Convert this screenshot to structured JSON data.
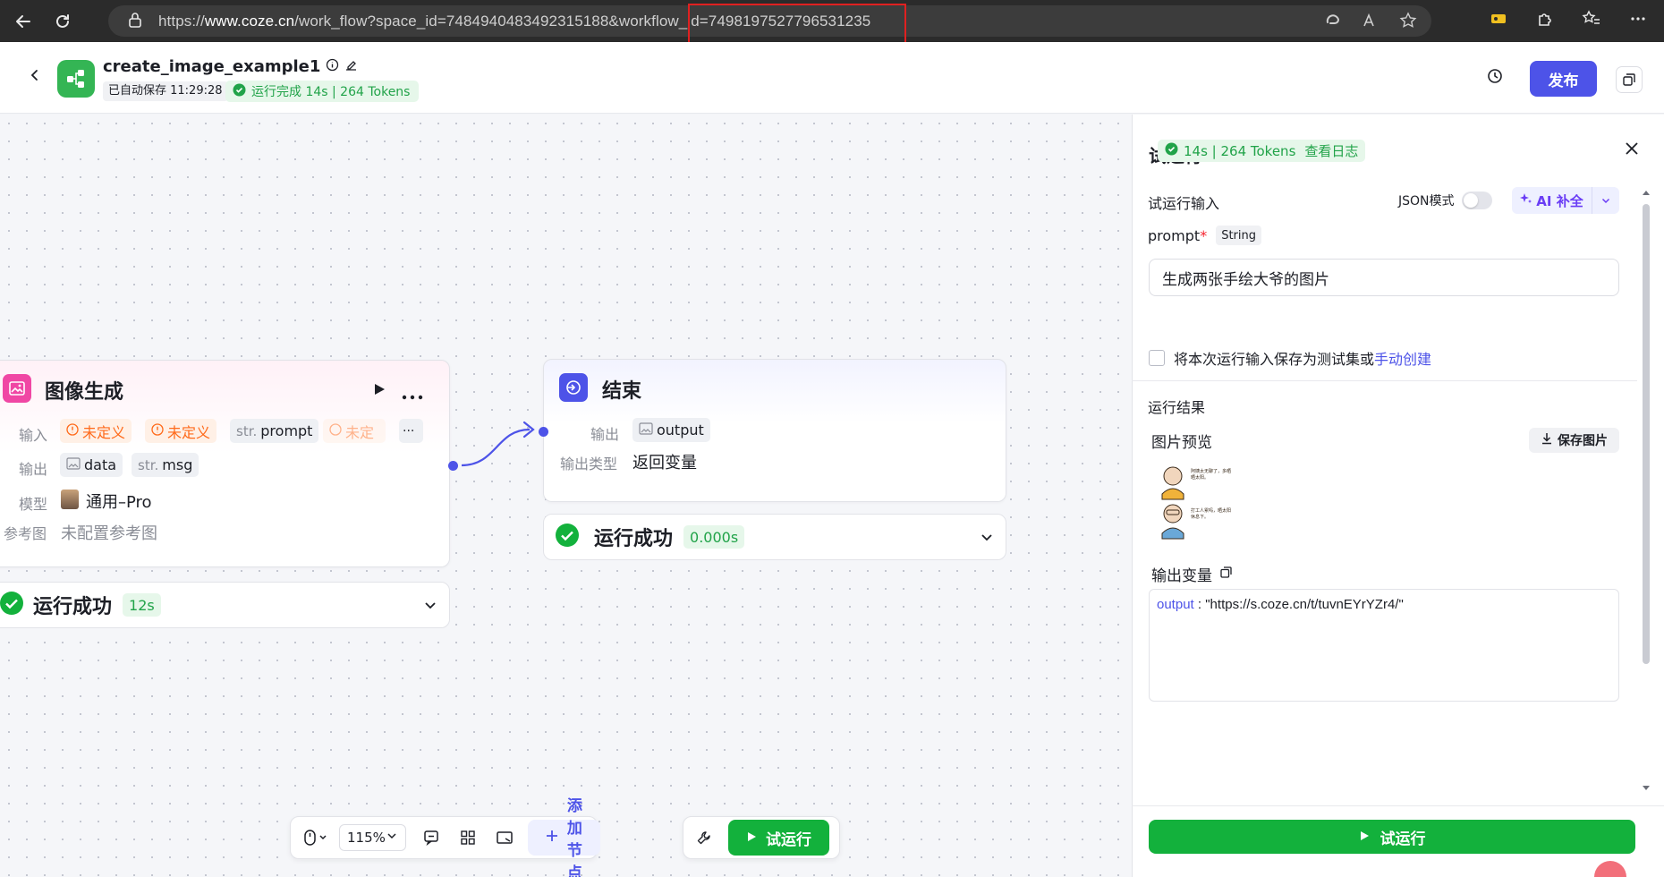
{
  "browser": {
    "url_prefix": "https://",
    "url_domain": "www.coze.cn",
    "url_path": "/work_flow?space_id=7484940483492315188&workflow_id=7498197527796531235"
  },
  "header": {
    "workflow_name": "create_image_example1",
    "autosave": "已自动保存 11:29:28",
    "run_status": "运行完成 14s | 264 Tokens",
    "publish_label": "发布"
  },
  "nodes": {
    "image_gen": {
      "title": "图像生成",
      "input_label": "输入",
      "inputs": [
        "未定义",
        "未定义",
        "prompt",
        "未定"
      ],
      "str_prefix": "str.",
      "more_label": "···",
      "output_label": "输出",
      "outputs": [
        "data",
        "msg"
      ],
      "model_label": "模型",
      "model_value": "通用–Pro",
      "ref_label": "参考图",
      "ref_value": "未配置参考图",
      "status": "运行成功",
      "time": "12s"
    },
    "end": {
      "title": "结束",
      "output_label": "输出",
      "output_value": "output",
      "output_type_label": "输出类型",
      "output_type_value": "返回变量",
      "status": "运行成功",
      "time": "0.000s"
    }
  },
  "toolbar": {
    "zoom": "115%",
    "add_node_label": "添加节点",
    "trial_run_label": "试运行"
  },
  "panel": {
    "title": "试运行",
    "stat": "14s | 264 Tokens",
    "view_log": "查看日志",
    "input_section": "试运行输入",
    "json_mode": "JSON模式",
    "ai_complete": "AI 补全",
    "prompt_label": "prompt",
    "prompt_required": "*",
    "prompt_type": "String",
    "prompt_value": "生成两张手绘大爷的图片",
    "save_text": "将本次运行输入保存为测试集或",
    "manual_create": "手动创建",
    "result_section": "运行结果",
    "preview_label": "图片预览",
    "save_image": "保存图片",
    "thumb_text_1": "阿姨太无聊了，多晒晒太阳。",
    "thumb_text_2": "打工人累吗，晒太阳休息下。",
    "output_var_label": "输出变量",
    "output_key": "output",
    "output_sep": " : ",
    "output_value": "\"https://s.coze.cn/t/tuvnEYrYZr4/\"",
    "run_button": "试运行"
  },
  "colors": {
    "brand": "#4d53e8",
    "success": "#13b13c",
    "warning": "#ff6a1a"
  }
}
